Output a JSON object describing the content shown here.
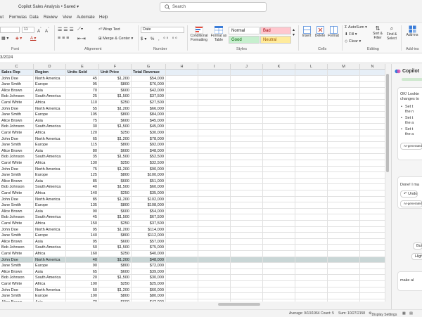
{
  "titlebar": {
    "file_name": "Copilot Sales Analysis • Saved ▾"
  },
  "search": {
    "placeholder": "Search"
  },
  "menu": [
    "ut",
    "Formulas",
    "Data",
    "Review",
    "View",
    "Automate",
    "Help"
  ],
  "ribbon": {
    "font_size": "11",
    "group_labels": {
      "font": "Font",
      "alignment": "Alignment",
      "number": "Number",
      "styles": "Styles",
      "cells": "Cells",
      "editing": "Editing",
      "addins": "Add-ins"
    },
    "wrap_text": "Wrap Text",
    "merge_center": "Merge & Center",
    "number_format": "Date",
    "conditional_formatting": "Conditional Formatting",
    "format_as_table": "Format as Table",
    "styles": {
      "normal": "Normal",
      "bad": "Bad",
      "good": "Good",
      "neutral": "Neutral"
    },
    "style_colors": {
      "normal": "#ffffff",
      "bad": "#ffc7ce",
      "good": "#c6efce",
      "neutral": "#ffeb9c"
    },
    "cells_buttons": [
      "Insert",
      "Delete",
      "Format"
    ],
    "autosum": "AutoSum",
    "fill": "Fill",
    "clear": "Clear",
    "sort_filter": "Sort & Filter",
    "find_select": "Find & Select",
    "addins": "Add-ins"
  },
  "formula_bar": {
    "name_box": "3/2024"
  },
  "columns": [
    "C",
    "D",
    "E",
    "F",
    "G",
    "H",
    "I",
    "J",
    "K",
    "L",
    "M",
    "N"
  ],
  "table": {
    "headers": [
      "Sales Rep",
      "Region",
      "Units Sold",
      "Unit Price",
      "Total Revenue"
    ],
    "rows": [
      [
        "John Doe",
        "North America",
        "45",
        "$1,200",
        "$54,000"
      ],
      [
        "Jane Smith",
        "Europe",
        "95",
        "$800",
        "$76,000"
      ],
      [
        "Alice Brown",
        "Asia",
        "70",
        "$600",
        "$42,000"
      ],
      [
        "Bob Johnson",
        "South America",
        "25",
        "$1,500",
        "$37,500"
      ],
      [
        "Carol White",
        "Africa",
        "110",
        "$250",
        "$27,500"
      ],
      [
        "John Doe",
        "North America",
        "55",
        "$1,200",
        "$66,000"
      ],
      [
        "Jane Smith",
        "Europe",
        "105",
        "$800",
        "$84,000"
      ],
      [
        "Alice Brown",
        "Asia",
        "75",
        "$600",
        "$45,000"
      ],
      [
        "Bob Johnson",
        "South America",
        "30",
        "$1,500",
        "$45,000"
      ],
      [
        "Carol White",
        "Africa",
        "120",
        "$250",
        "$30,000"
      ],
      [
        "John Doe",
        "North America",
        "65",
        "$1,200",
        "$78,000"
      ],
      [
        "Jane Smith",
        "Europe",
        "115",
        "$800",
        "$92,000"
      ],
      [
        "Alice Brown",
        "Asia",
        "80",
        "$600",
        "$48,000"
      ],
      [
        "Bob Johnson",
        "South America",
        "35",
        "$1,500",
        "$52,500"
      ],
      [
        "Carol White",
        "Africa",
        "130",
        "$250",
        "$32,500"
      ],
      [
        "John Doe",
        "North America",
        "75",
        "$1,200",
        "$90,000"
      ],
      [
        "Jane Smith",
        "Europe",
        "125",
        "$800",
        "$100,000"
      ],
      [
        "Alice Brown",
        "Asia",
        "85",
        "$600",
        "$51,000"
      ],
      [
        "Bob Johnson",
        "South America",
        "40",
        "$1,500",
        "$60,000"
      ],
      [
        "Carol White",
        "Africa",
        "140",
        "$250",
        "$35,000"
      ],
      [
        "John Doe",
        "North America",
        "85",
        "$1,200",
        "$102,000"
      ],
      [
        "Jane Smith",
        "Europe",
        "135",
        "$800",
        "$108,000"
      ],
      [
        "Alice Brown",
        "Asia",
        "90",
        "$600",
        "$54,000"
      ],
      [
        "Bob Johnson",
        "South America",
        "45",
        "$1,500",
        "$67,500"
      ],
      [
        "Carol White",
        "Africa",
        "150",
        "$250",
        "$37,500"
      ],
      [
        "John Doe",
        "North America",
        "95",
        "$1,200",
        "$114,000"
      ],
      [
        "Jane Smith",
        "Europe",
        "140",
        "$800",
        "$112,000"
      ],
      [
        "Alice Brown",
        "Asia",
        "95",
        "$600",
        "$57,000"
      ],
      [
        "Bob Johnson",
        "South America",
        "50",
        "$1,500",
        "$75,000"
      ],
      [
        "Carol White",
        "Africa",
        "160",
        "$250",
        "$40,000"
      ],
      [
        "John Doe",
        "North America",
        "40",
        "$1,200",
        "$48,000"
      ],
      [
        "Jane Smith",
        "Europe",
        "90",
        "$800",
        "$72,000"
      ],
      [
        "Alice Brown",
        "Asia",
        "65",
        "$600",
        "$39,000"
      ],
      [
        "Bob Johnson",
        "South America",
        "20",
        "$1,500",
        "$30,000"
      ],
      [
        "Carol White",
        "Africa",
        "100",
        "$250",
        "$25,000"
      ],
      [
        "John Doe",
        "North America",
        "50",
        "$1,200",
        "$60,000"
      ],
      [
        "Jane Smith",
        "Europe",
        "100",
        "$800",
        "$80,000"
      ],
      [
        "Alice Brown",
        "Asia",
        "70",
        "$600",
        "$42,000"
      ]
    ],
    "selected_row_index": 30,
    "header_fill": "#e7eff7",
    "selected_fill": "#c9d6d6"
  },
  "copilot": {
    "title": "Copilot",
    "message1": [
      "OK! Lookin",
      "changes to"
    ],
    "bullets": [
      [
        "Set t",
        "the n"
      ],
      [
        "Set t",
        "the a"
      ],
      [
        "Set t",
        "the a"
      ]
    ],
    "generated1": "AI-generated",
    "message2": "Done! I ma",
    "undo": "Undo",
    "generated2": "AI-generated",
    "chip1": "Bui",
    "chip2": "High",
    "input_text": "make al"
  },
  "status": {
    "average": "Average: 9/13/1964",
    "count": "Count: 5",
    "sum": "Sum: 10/27/2158",
    "display_settings": "Display Settings"
  }
}
